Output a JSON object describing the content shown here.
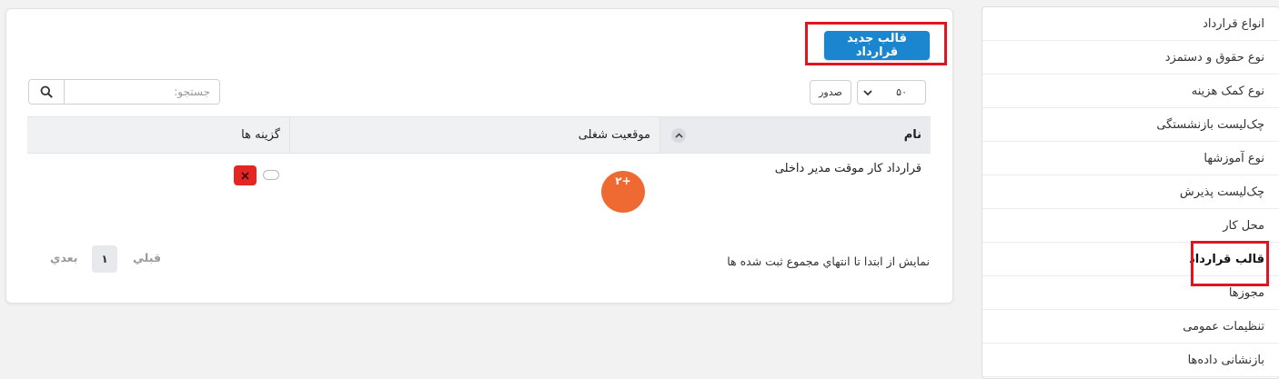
{
  "sidebar": {
    "items": [
      {
        "label": "انواع قرارداد"
      },
      {
        "label": "نوع حقوق و دستمزد"
      },
      {
        "label": "نوع کمک هزینه"
      },
      {
        "label": "چک‌لیست بازنشستگی"
      },
      {
        "label": "نوع آموزشها"
      },
      {
        "label": "چک‌لیست پذیرش"
      },
      {
        "label": "محل کار"
      },
      {
        "label": "قالب قرارداد"
      },
      {
        "label": "مجوزها"
      },
      {
        "label": "تنظیمات عمومی"
      },
      {
        "label": "بازنشانی داده‌ها"
      }
    ],
    "active_label": "قالب قرارداد"
  },
  "toolbar": {
    "new_button_label": "قالب جدید قرارداد",
    "export_label": "صدور",
    "page_length_value": "۵۰"
  },
  "search": {
    "placeholder": "جستجو:"
  },
  "table": {
    "columns": {
      "name": "نام",
      "position": "موقعیت شغلی",
      "options": "گزینه ها"
    },
    "rows": [
      {
        "name": "قرارداد کار موقت مدیر داخلی",
        "position_badge": "۲+"
      }
    ]
  },
  "footer": {
    "info": "نمایش از ابتدا تا انتهاي مجموع ثبت شده ها",
    "prev_label": "قبلي",
    "page_number": "۱",
    "next_label": "بعدي"
  },
  "colors": {
    "primary": "#1a86cf",
    "badge": "#ef6a33",
    "danger": "#e52521",
    "highlight": "#e1151f"
  }
}
